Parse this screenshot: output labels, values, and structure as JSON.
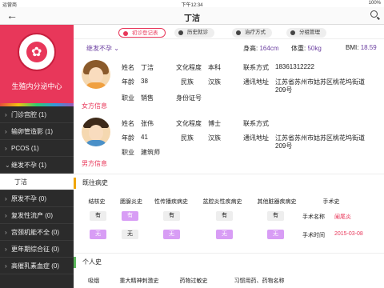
{
  "status": {
    "carrier": "运营商",
    "time": "下午12:34",
    "battery": "100%"
  },
  "nav": {
    "title": "丁洁"
  },
  "sidebar": {
    "brand": "生殖内分泌中心",
    "items": [
      {
        "label": "门诊宫腔 (1)",
        "arrow": "›"
      },
      {
        "label": "输卵管造影 (1)",
        "arrow": "›"
      },
      {
        "label": "PCOS (1)",
        "arrow": "›"
      },
      {
        "label": "继发不孕 (1)",
        "arrow": "⌄"
      },
      {
        "label": "丁洁",
        "arrow": ""
      },
      {
        "label": "原发不孕 (0)",
        "arrow": "›"
      },
      {
        "label": "复发性流产 (0)",
        "arrow": "›"
      },
      {
        "label": "宫颈机能不全 (0)",
        "arrow": "›"
      },
      {
        "label": "更年期综合征 (0)",
        "arrow": "›"
      },
      {
        "label": "高催乳素血症 (0)",
        "arrow": "›"
      }
    ]
  },
  "tabs": [
    "初诊登记表",
    "历史就诊",
    "治疗方式",
    "分组管理"
  ],
  "metrics": {
    "category": "继发不孕",
    "height_label": "身高:",
    "height": "164cm",
    "weight_label": "体重:",
    "weight": "50kg",
    "bmi_label": "BMI:",
    "bmi": "18.59"
  },
  "female": {
    "link": "女方信息",
    "name_l": "姓名",
    "name": "丁洁",
    "edu_l": "文化程度",
    "edu": "本科",
    "phone_l": "联系方式",
    "phone": "18361312222",
    "age_l": "年龄",
    "age": "38",
    "eth_l": "民族",
    "eth": "汉族",
    "addr_l": "通讯地址",
    "addr1": "江苏省苏州市姑苏区桃花坞街道",
    "addr2": "209号",
    "job_l": "职业",
    "job": "销售",
    "id_l": "身份证号"
  },
  "male": {
    "link": "男方信息",
    "name_l": "姓名",
    "name": "张伟",
    "edu_l": "文化程度",
    "edu": "博士",
    "phone_l": "联系方式",
    "age_l": "年龄",
    "age": "41",
    "eth_l": "民族",
    "eth": "汉族",
    "addr_l": "通讯地址",
    "addr1": "江苏省苏州市姑苏区桃花坞街道",
    "addr2": "209号",
    "job_l": "职业",
    "job": "建筑师"
  },
  "history": {
    "title": "既往病史",
    "headers": [
      "结核史",
      "腮腺炎史",
      "性传播疾病史",
      "盆腔炎性疾病史",
      "其他脏器疾病史",
      "手术史"
    ],
    "yes": "有",
    "no": "无",
    "surgery_name_l": "手术名称",
    "surgery_name": "阑尾炎",
    "surgery_time_l": "手术时间",
    "surgery_time": "2015-03-08"
  },
  "personal": {
    "title": "个人史",
    "headers": [
      "吸烟",
      "重大精神刺激史",
      "药物过敏史",
      "习惯用药、药物名称"
    ]
  }
}
